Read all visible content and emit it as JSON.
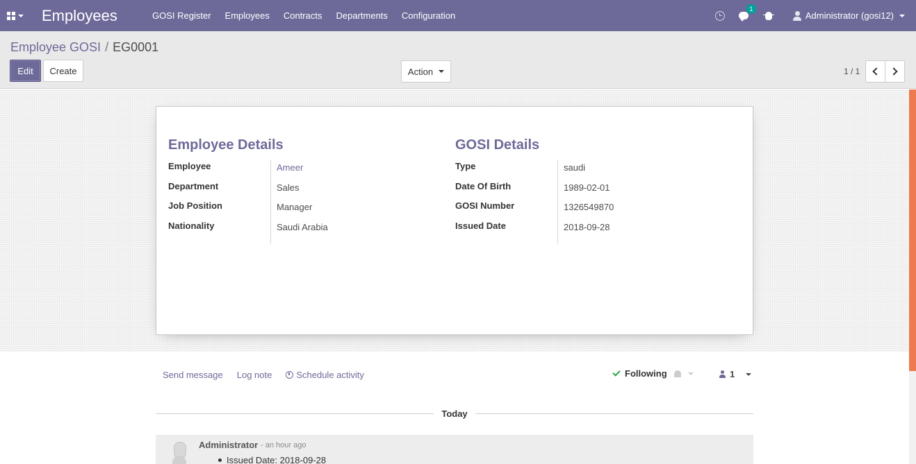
{
  "navbar": {
    "app_title": "Employees",
    "menu": [
      "GOSI Register",
      "Employees",
      "Contracts",
      "Departments",
      "Configuration"
    ],
    "chat_badge": "1",
    "user": "Administrator (gosi12)",
    "icons": [
      "apps-grid-icon",
      "clock-icon",
      "chat-icon",
      "bug-icon",
      "user-icon"
    ]
  },
  "breadcrumb": {
    "parent": "Employee GOSI",
    "separator": "/",
    "current": "EG0001"
  },
  "buttons": {
    "edit": "Edit",
    "create": "Create",
    "action": "Action"
  },
  "pager": {
    "value": "1 / 1"
  },
  "form": {
    "employee_details": {
      "title": "Employee Details",
      "fields": [
        {
          "label": "Employee",
          "value": "Ameer"
        },
        {
          "label": "Department",
          "value": "Sales"
        },
        {
          "label": "Job Position",
          "value": "Manager"
        },
        {
          "label": "Nationality",
          "value": "Saudi Arabia"
        }
      ]
    },
    "gosi_details": {
      "title": "GOSI Details",
      "fields": [
        {
          "label": "Type",
          "value": "saudi"
        },
        {
          "label": "Date Of Birth",
          "value": "1989-02-01"
        },
        {
          "label": "GOSI Number",
          "value": "1326549870"
        },
        {
          "label": "Issued Date",
          "value": "2018-09-28"
        }
      ]
    }
  },
  "chatter": {
    "send_message": "Send message",
    "log_note": "Log note",
    "schedule_activity": "Schedule activity",
    "following": "Following",
    "followers_count": "1",
    "date_separator": "Today",
    "message": {
      "author": "Administrator",
      "time": "- an hour ago",
      "line": "Issued Date: 2018-09-28"
    }
  },
  "colors": {
    "navbar": "#6d6a99",
    "accent": "#6d6a99",
    "scroll_thumb": "#ee7b50",
    "following_check": "#28a745"
  }
}
